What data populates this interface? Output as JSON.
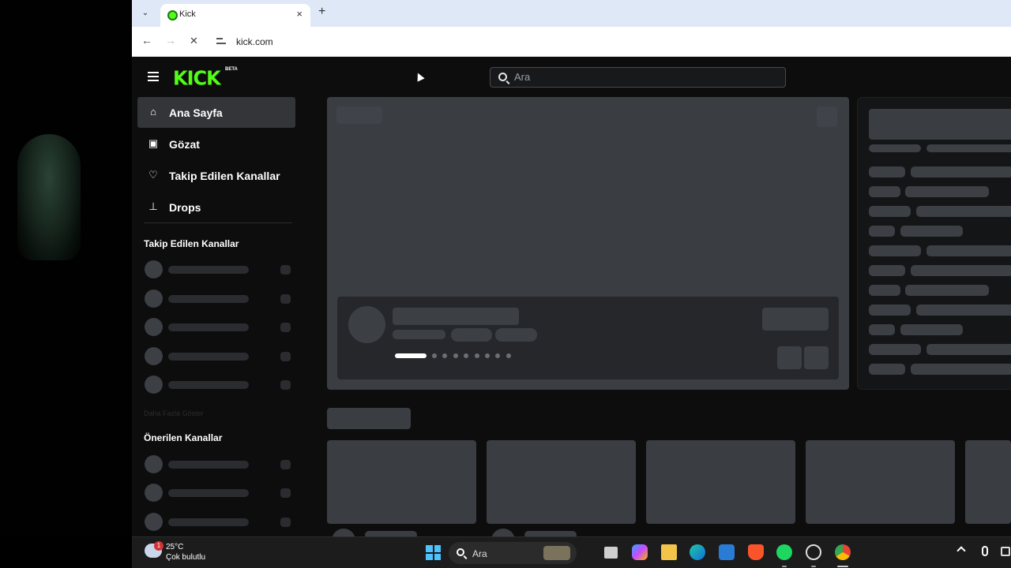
{
  "browser": {
    "tab_title": "Kick",
    "url": "kick.com",
    "new_tab_symbol": "+",
    "close_symbol": "×",
    "tab_menu_symbol": "⌄"
  },
  "header": {
    "logo": "KICK",
    "logo_badge": "BETA",
    "search_placeholder": "Ara",
    "accent_color": "#53fc18"
  },
  "sidebar": {
    "nav": [
      {
        "label": "Ana Sayfa",
        "icon": "home-icon",
        "active": true
      },
      {
        "label": "Gözat",
        "icon": "browse-icon"
      },
      {
        "label": "Takip Edilen Kanallar",
        "icon": "heart-icon"
      },
      {
        "label": "Drops",
        "icon": "drops-icon"
      }
    ],
    "followed_title": "Takip Edilen Kanallar",
    "show_more": "Daha Fazla Göster",
    "recommended_title": "Önerilen Kanallar"
  },
  "carousel": {
    "dot_count": 9,
    "active_dot": 0
  },
  "taskbar": {
    "temperature": "25°C",
    "weather": "Çok bulutlu",
    "weather_badge": "1",
    "search_placeholder": "Ara",
    "apps": [
      "task-view-icon",
      "copilot-icon",
      "file-explorer-icon",
      "edge-icon",
      "store-icon",
      "brave-icon",
      "spotify-icon",
      "settings-icon",
      "chrome-icon"
    ]
  }
}
